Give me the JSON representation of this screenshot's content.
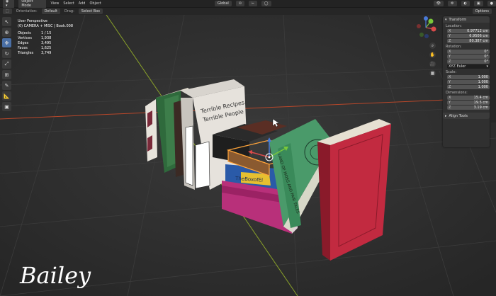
{
  "header": {
    "mode": "Object Mode",
    "menus": [
      "View",
      "Select",
      "Add",
      "Object"
    ],
    "transform_orientation": "Global",
    "options_label": "Options"
  },
  "tool_header": {
    "orientation_label": "Orientation:",
    "orientation_value": "Default",
    "drag_label": "Drag:",
    "drag_value": "Select Box"
  },
  "overlay": {
    "view_name": "User Perspective",
    "collection_line": "(0) CAMERA + MISC | Book.008",
    "stats": [
      {
        "key": "Objects",
        "value": "1 / 15"
      },
      {
        "key": "Vertices",
        "value": "1,938"
      },
      {
        "key": "Edges",
        "value": "3,495"
      },
      {
        "key": "Faces",
        "value": "1,625"
      },
      {
        "key": "Triangles",
        "value": "3,749"
      }
    ]
  },
  "npanel": {
    "title": "Transform",
    "location_label": "Location:",
    "location": [
      {
        "axis": "X",
        "value": "0.97712 cm"
      },
      {
        "axis": "Y",
        "value": "6.9506 cm"
      },
      {
        "axis": "Z",
        "value": "80.387 cm"
      }
    ],
    "rotation_label": "Rotation:",
    "rotation": [
      {
        "axis": "X",
        "value": "0°"
      },
      {
        "axis": "Y",
        "value": "0°"
      },
      {
        "axis": "Z",
        "value": "0°"
      }
    ],
    "rotation_mode": "XYZ Euler",
    "scale_label": "Scale:",
    "scale": [
      {
        "axis": "X",
        "value": "1.000"
      },
      {
        "axis": "Y",
        "value": "1.000"
      },
      {
        "axis": "Z",
        "value": "1.000"
      }
    ],
    "dimensions_label": "Dimensions:",
    "dimensions": [
      {
        "axis": "X",
        "value": "15.4 cm"
      },
      {
        "axis": "Y",
        "value": "19.5 cm"
      },
      {
        "axis": "Z",
        "value": "3.19 cm"
      }
    ],
    "align_tools": "Align Tools"
  },
  "books": {
    "recipes_title_1": "Terrible Recipes",
    "recipes_title_2": "Terrible People",
    "blue_spine": "TheBoxofEl",
    "green_spine": "LAND OF MOSS AND FAIR TALES"
  },
  "signature": "Bailey",
  "colors": {
    "background": "#2a2a2a",
    "axis_x": "#b7472a",
    "axis_y": "#8aa22a",
    "selection": "#ffa43a",
    "accent": "#4a6fa5"
  }
}
